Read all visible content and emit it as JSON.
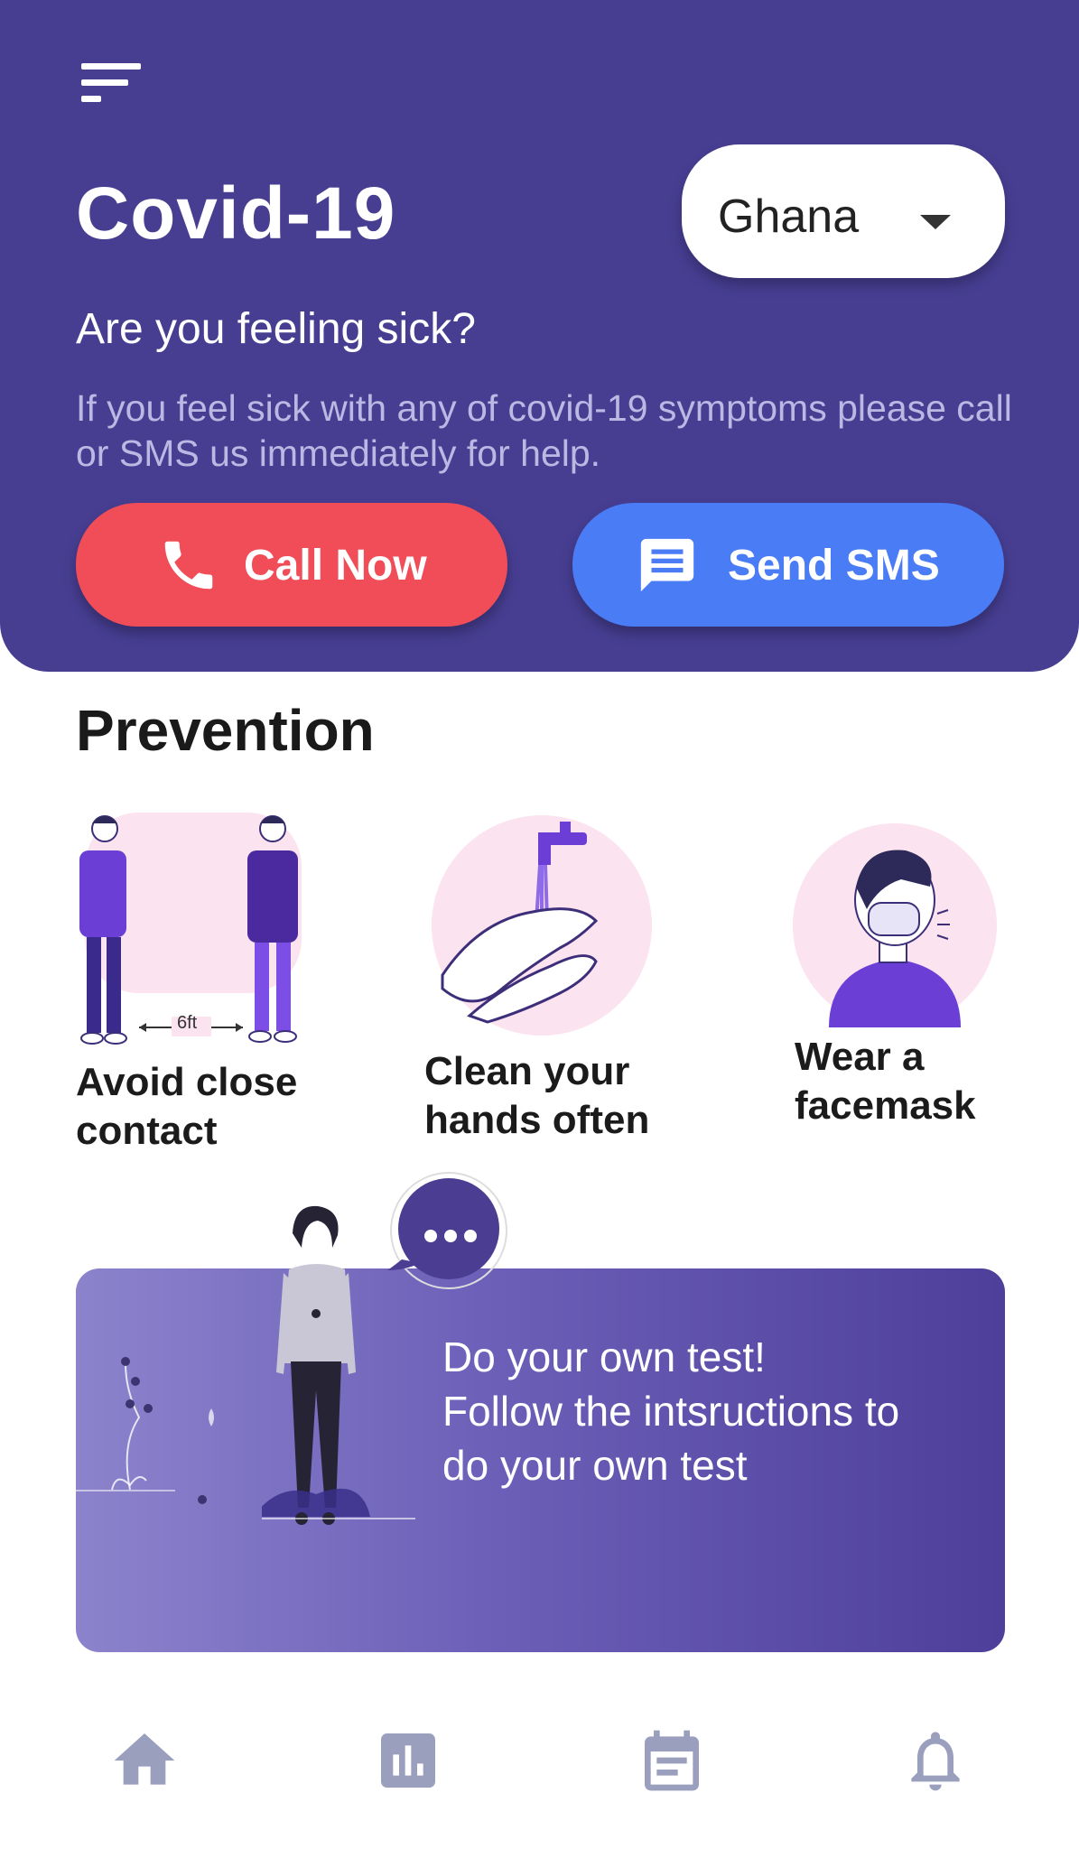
{
  "header": {
    "title": "Covid-19",
    "country_value": "Ghana",
    "question": "Are you feeling sick?",
    "description": "If you feel sick with any of covid-19 symptoms please call or SMS us immediately for help.",
    "call_label": "Call Now",
    "sms_label": "Send SMS"
  },
  "prevention": {
    "title": "Prevention",
    "items": [
      {
        "label": "Avoid close\n contact",
        "icon": "distance-illustration",
        "distance_text": "6ft"
      },
      {
        "label": "Clean your\n hands often",
        "icon": "handwash-illustration"
      },
      {
        "label": "Wear a\n facemask",
        "icon": "facemask-illustration"
      }
    ]
  },
  "banner": {
    "line1": "Do your own test!",
    "line2": "Follow the intsructions to",
    "line3": "do your own test"
  },
  "bottom_nav": {
    "items": [
      "home-icon",
      "stats-icon",
      "calendar-icon",
      "bell-icon"
    ]
  },
  "colors": {
    "header_bg": "#473e92",
    "call_button": "#f04d59",
    "sms_button": "#4a7cf5",
    "nav_icon": "#9b9fbe",
    "illustration_pink": "#fbe3ef",
    "illustration_purple": "#6b3fd6"
  }
}
